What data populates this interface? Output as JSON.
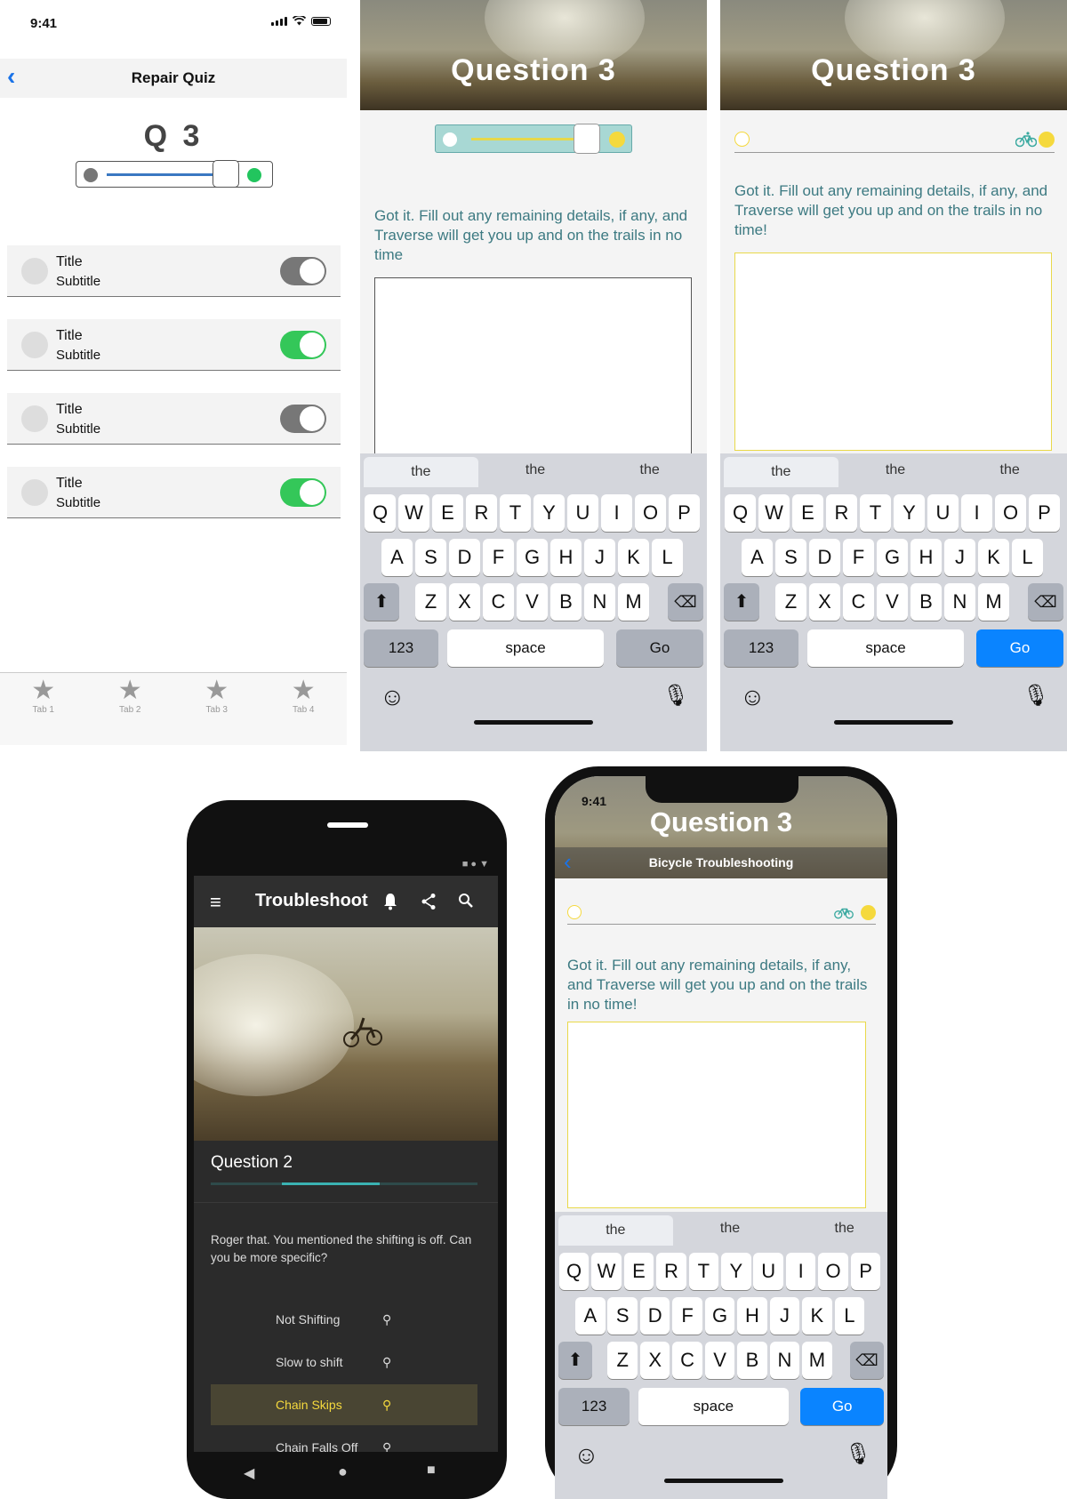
{
  "panel1": {
    "time": "9:41",
    "nav_title": "Repair Quiz",
    "heading": "Q 3",
    "rows": [
      {
        "title": "Title",
        "subtitle": "Subtitle",
        "on": false
      },
      {
        "title": "Title",
        "subtitle": "Subtitle",
        "on": true
      },
      {
        "title": "Title",
        "subtitle": "Subtitle",
        "on": false
      },
      {
        "title": "Title",
        "subtitle": "Subtitle",
        "on": true
      }
    ],
    "tabs": [
      "Tab 1",
      "Tab 2",
      "Tab 3",
      "Tab 4"
    ]
  },
  "panel2": {
    "title": "Question  3",
    "text": "Got it. Fill out any remaining details, if any, and Traverse will get you up and on the trails in no time",
    "progress": 0.77
  },
  "panel3": {
    "title": "Question  3",
    "text": "Got it. Fill out any remaining details, if any, and Traverse will get you up and on the trails in no time!"
  },
  "keyboard": {
    "suggestions": [
      "the",
      "the",
      "the"
    ],
    "row1": [
      "Q",
      "W",
      "E",
      "R",
      "T",
      "Y",
      "U",
      "I",
      "O",
      "P"
    ],
    "row2": [
      "A",
      "S",
      "D",
      "F",
      "G",
      "H",
      "J",
      "K",
      "L"
    ],
    "row3": [
      "Z",
      "X",
      "C",
      "V",
      "B",
      "N",
      "M"
    ],
    "numbers_label": "123",
    "space_label": "space",
    "go_label": "Go"
  },
  "android": {
    "app_title": "Troubleshoot",
    "question": "Question 2",
    "progress": 0.37,
    "prompt": "Roger that. You mentioned the shifting is off. Can you be more specific?",
    "options": [
      "Not Shifting",
      "Slow to shift",
      "Chain Skips",
      "Chain Falls Off"
    ],
    "selected_option": "Chain Skips"
  },
  "iphone": {
    "time": "9:41",
    "title": "Question  3",
    "subtitle": "Bicycle Troubleshooting",
    "text": "Got it. Fill out any remaining details, if any, and Traverse will get you up and on the trails in no time!"
  },
  "colors": {
    "accent_teal": "#3d7a82",
    "yellow": "#f5d93d",
    "ios_blue": "#0a84ff",
    "toggle_green": "#34c759"
  },
  "icons": [
    "back-chevron-icon",
    "star-icon",
    "bicycle-icon",
    "menu-icon",
    "bell-icon",
    "share-icon",
    "search-icon",
    "shift-icon",
    "backspace-icon",
    "emoji-icon",
    "microphone-icon"
  ]
}
